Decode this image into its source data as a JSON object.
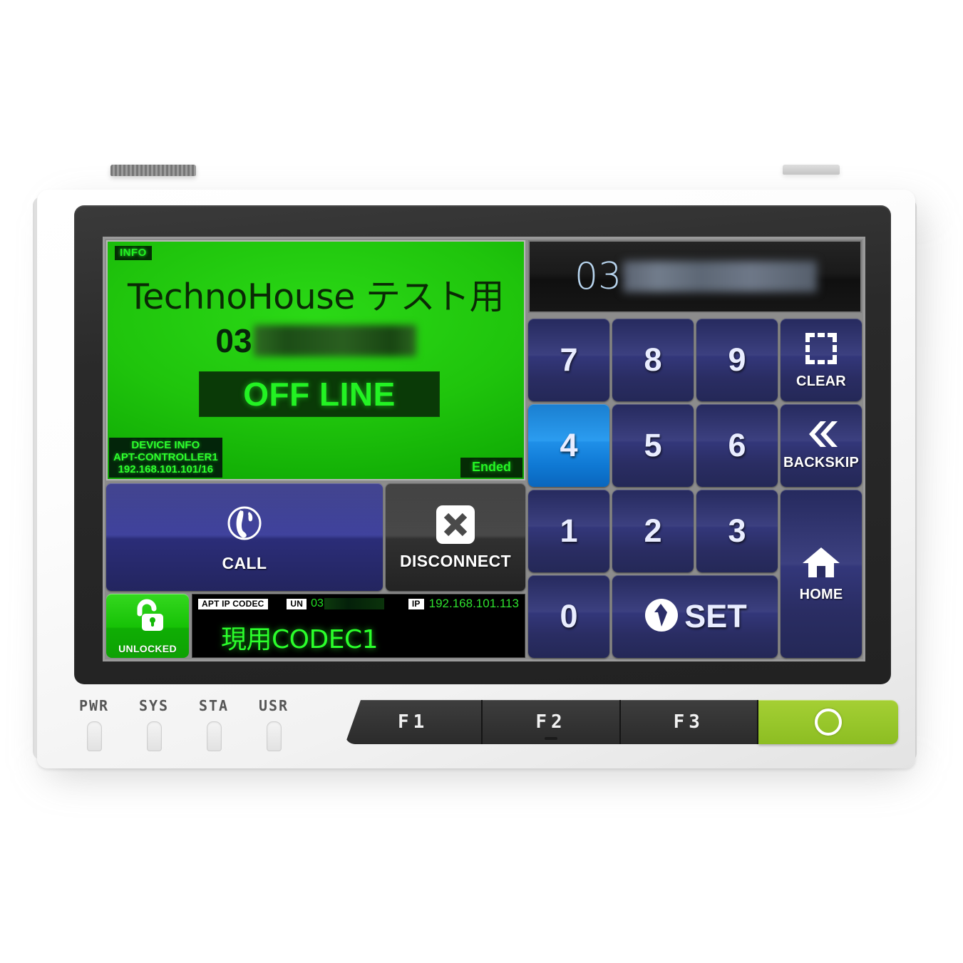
{
  "device": {
    "leds": [
      {
        "name": "PWR"
      },
      {
        "name": "SYS"
      },
      {
        "name": "STA"
      },
      {
        "name": "USR"
      }
    ],
    "function_keys": [
      {
        "label": "F1",
        "name": "f1"
      },
      {
        "label": "F2",
        "name": "f2"
      },
      {
        "label": "F3",
        "name": "f3"
      }
    ],
    "power_button": {
      "icon": "power-ring-icon",
      "label": ""
    }
  },
  "info_panel": {
    "badge": "INFO",
    "title": "TechnoHouse テスト用",
    "number_prefix": "03",
    "number_redacted": true,
    "call_state": "OFF LINE",
    "ended_badge": "Ended",
    "device_info": {
      "heading": "DEVICE INFO",
      "hostname": "APT-CONTROLLER1",
      "address": "192.168.101.101/16"
    }
  },
  "actions": {
    "call": {
      "label": "CALL",
      "icon": "phone-handset-icon"
    },
    "disconnect": {
      "label": "DISCONNECT",
      "icon": "x-cross-icon"
    }
  },
  "codec_status": {
    "lock": {
      "label": "UNLOCKED",
      "icon": "open-padlock-icon"
    },
    "tag": "APT IP CODEC",
    "un_tag": "UN",
    "un_value": "03",
    "un_redacted": true,
    "ip_tag": "IP",
    "ip_value": "192.168.101.113",
    "codec_name": "現用CODEC1"
  },
  "keypad": {
    "display": {
      "prefix": "03",
      "redacted": true
    },
    "keys": [
      {
        "name": "key-7",
        "label": "7",
        "type": "digit",
        "active": false
      },
      {
        "name": "key-8",
        "label": "8",
        "type": "digit",
        "active": false
      },
      {
        "name": "key-9",
        "label": "9",
        "type": "digit",
        "active": false
      },
      {
        "name": "key-clear",
        "label": "CLEAR",
        "type": "func",
        "icon": "dashed-square-icon",
        "active": false
      },
      {
        "name": "key-4",
        "label": "4",
        "type": "digit",
        "active": true
      },
      {
        "name": "key-5",
        "label": "5",
        "type": "digit",
        "active": false
      },
      {
        "name": "key-6",
        "label": "6",
        "type": "digit",
        "active": false
      },
      {
        "name": "key-backskip",
        "label": "BACKSKIP",
        "type": "func",
        "icon": "double-chevron-left-icon",
        "active": false
      },
      {
        "name": "key-1",
        "label": "1",
        "type": "digit",
        "active": false
      },
      {
        "name": "key-2",
        "label": "2",
        "type": "digit",
        "active": false
      },
      {
        "name": "key-3",
        "label": "3",
        "type": "digit",
        "active": false
      },
      {
        "name": "key-home",
        "label": "HOME",
        "type": "func",
        "icon": "house-icon",
        "active": false
      },
      {
        "name": "key-0",
        "label": "0",
        "type": "digit",
        "active": false
      },
      {
        "name": "key-set",
        "label": "SET",
        "type": "func",
        "icon": "enter-arrow-circle-icon",
        "active": false
      }
    ]
  },
  "colors": {
    "info_green": "#1fc40c",
    "offline_green": "#23f223",
    "key_blue": "#2a2d63",
    "key_active_blue": "#1f8fe8",
    "call_blue": "#2d2f82",
    "disconnect_grey": "#383838",
    "unlock_green": "#16c206",
    "power_green": "#98c72b"
  }
}
